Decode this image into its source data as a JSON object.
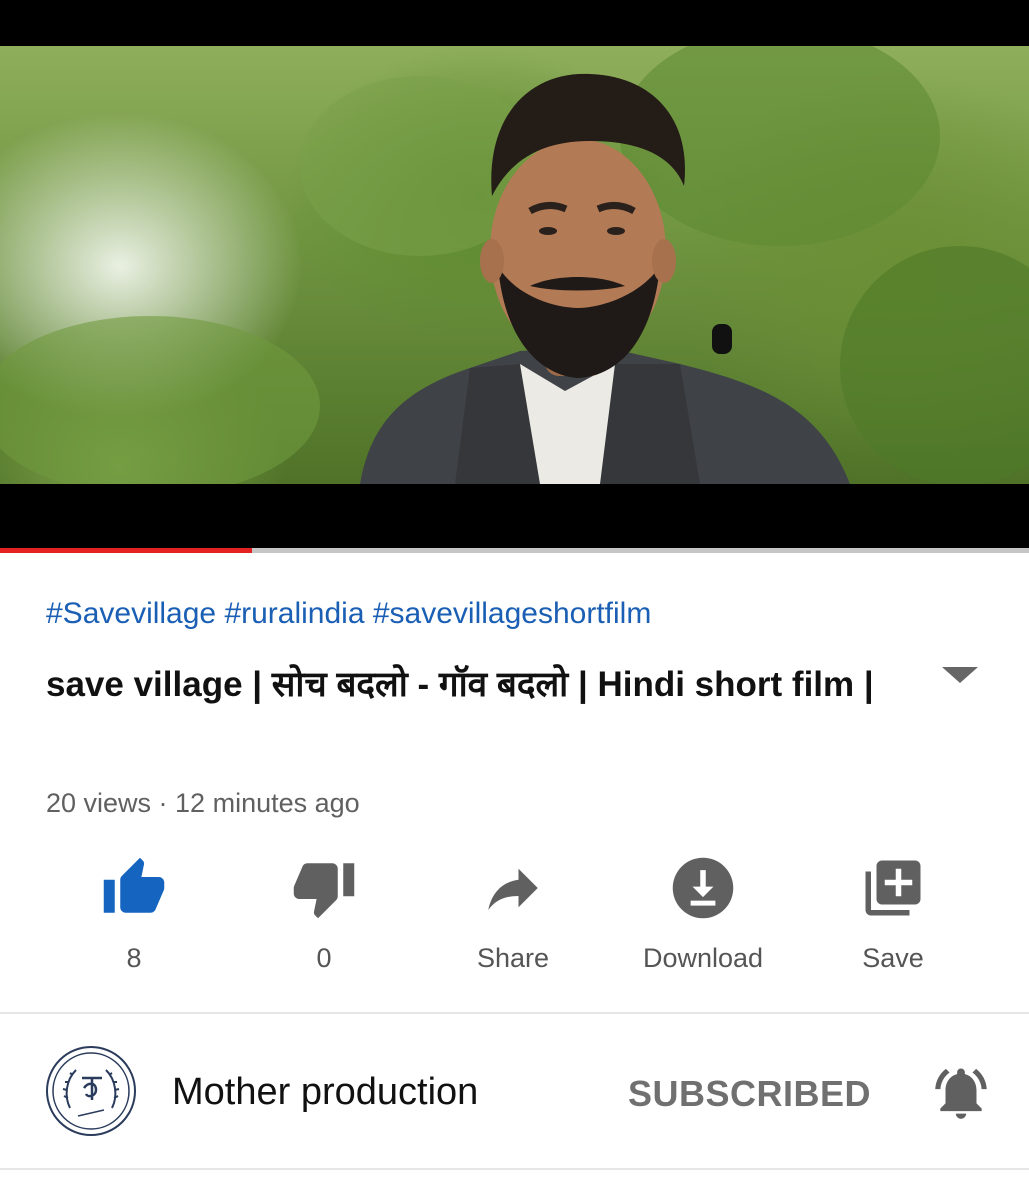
{
  "video": {
    "progress_percent": 24.5
  },
  "info": {
    "hashtags": "#Savevillage #ruralindia #savevillageshortfilm",
    "title": "save village | सोच बदलो - गॉव बदलो | Hindi short film |",
    "meta": "20 views · 12 minutes ago"
  },
  "actions": {
    "like_count": "8",
    "dislike_count": "0",
    "share_label": "Share",
    "download_label": "Download",
    "save_label": "Save"
  },
  "channel": {
    "name": "Mother production",
    "subscribe_label": "SUBSCRIBED"
  },
  "colors": {
    "like_active": "#1565c0",
    "progress": "#e52222",
    "hashtag": "#1a5fb4"
  }
}
